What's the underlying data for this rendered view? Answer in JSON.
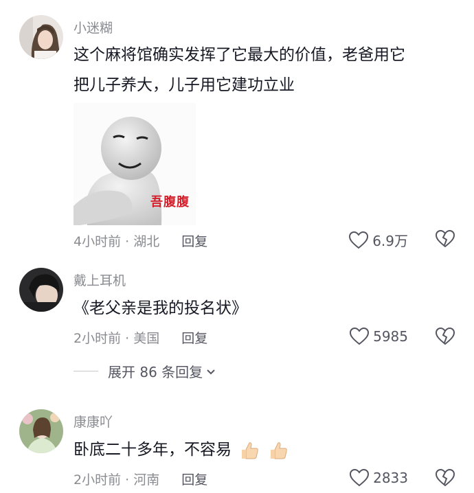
{
  "comments": [
    {
      "username": "小迷糊",
      "text_line1": "这个麻将馆确实发挥了它最大的价值，老爸用它",
      "text_line2": "把儿子养大，儿子用它建功立业",
      "sticker_text": "吾腹腹",
      "meta": "4小时前 · 湖北",
      "reply_label": "回复",
      "like_count": "6.9万"
    },
    {
      "username": "戴上耳机",
      "text_line1": "《老父亲是我的投名状》",
      "meta": "2小时前 · 美国",
      "reply_label": "回复",
      "like_count": "5985",
      "expand_label": "展开 86 条回复"
    },
    {
      "username": "康康吖",
      "text_line1": "卧底二十多年，不容易",
      "meta": "2小时前 · 河南",
      "reply_label": "回复",
      "like_count": "2833"
    }
  ],
  "icons": [
    "heart-outline-icon",
    "broken-heart-icon",
    "chevron-down-icon",
    "thumbs-up-emoji"
  ],
  "colors": {
    "text": "#161823",
    "secondary": "#8a8b91",
    "sticker_red": "#d51f2b"
  }
}
